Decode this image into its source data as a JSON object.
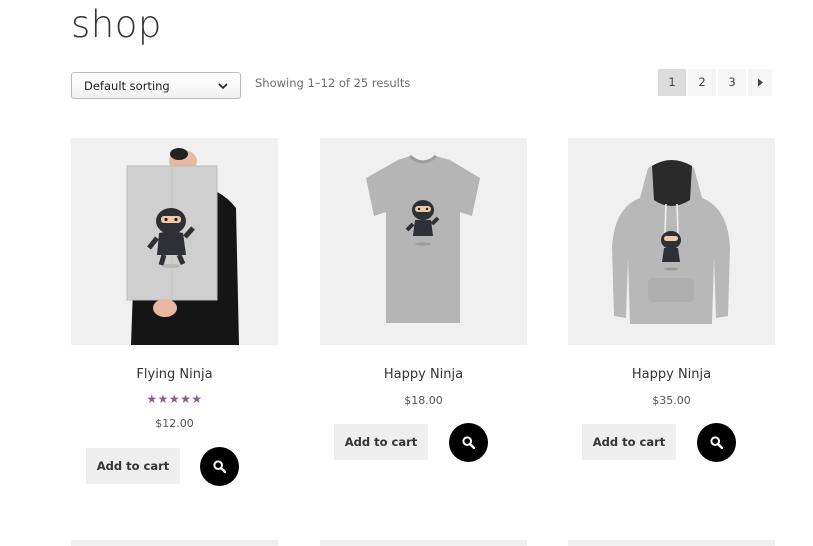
{
  "page": {
    "title": "shop"
  },
  "toolbar": {
    "sort_label": "Default sorting",
    "result_count": "Showing 1–12 of 25 results"
  },
  "pagination": {
    "pages": [
      "1",
      "2",
      "3"
    ],
    "current": "1",
    "next_icon": "caret-right-icon"
  },
  "products": [
    {
      "name": "Flying Ninja",
      "rating": "★★★★★",
      "rating_value": 5,
      "price": "$12.00",
      "add_to_cart": "Add to cart",
      "image": "ninja-poster"
    },
    {
      "name": "Happy Ninja",
      "price": "$18.00",
      "add_to_cart": "Add to cart",
      "image": "ninja-tshirt"
    },
    {
      "name": "Happy Ninja",
      "price": "$35.00",
      "add_to_cart": "Add to cart",
      "image": "ninja-hoodie"
    }
  ],
  "colors": {
    "rating": "#96588a",
    "button_bg": "#eeeeee",
    "quick_view_bg": "#000000",
    "thumb_bg": "#f0f0f0"
  }
}
